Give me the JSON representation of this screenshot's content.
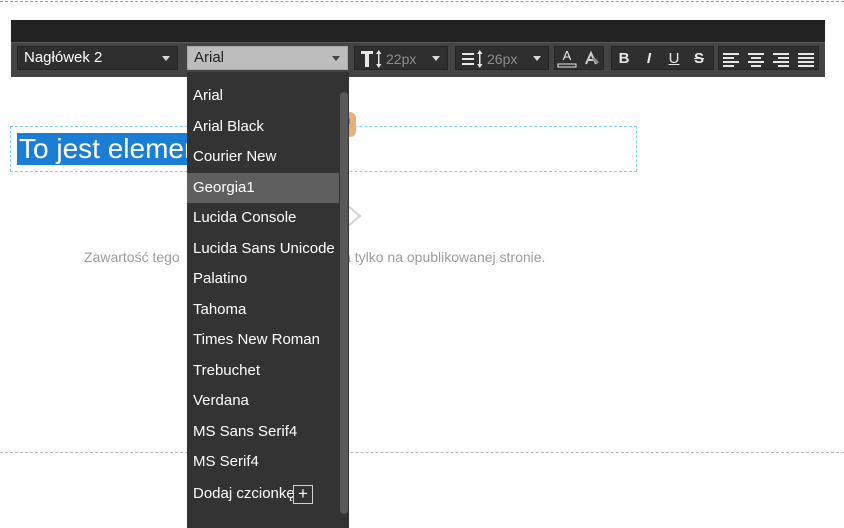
{
  "toolbar": {
    "heading_select": "Nagłówek 2",
    "font_select": "Arial",
    "font_size": "22px",
    "line_height": "26px",
    "bold_label": "B",
    "italic_label": "I",
    "underline_label": "U",
    "strike_label": "S",
    "font_color_label": "A"
  },
  "content": {
    "heading_text": "To jest elemen",
    "notice_text": "Zawartość tego                                        na tylko na opublikowanej stronie."
  },
  "dropdown": {
    "items": [
      "Arial",
      "Arial Black",
      "Courier New",
      "Georgia1",
      "Lucida Console",
      "Lucida Sans Unicode",
      "Palatino",
      "Tahoma",
      "Times New Roman",
      "Trebuchet",
      "Verdana",
      "MS Sans Serif4",
      "MS Serif4",
      "Dodaj czcionkę"
    ],
    "highlighted": "Georgia1",
    "add_label": "+"
  },
  "colors": {
    "toolbar_bg": "#444444",
    "dropdown_bg": "#333333",
    "highlight": "#5f5f5f",
    "selection": "#1a7fd4",
    "badge": "#e3b27c"
  },
  "icons": [
    "text-size-icon",
    "line-height-icon",
    "font-color-icon",
    "highlight-icon",
    "align-left-icon",
    "align-center-icon",
    "align-right-icon",
    "align-justify-icon",
    "external-link-icon",
    "chevron-right-icon",
    "plus-icon"
  ]
}
